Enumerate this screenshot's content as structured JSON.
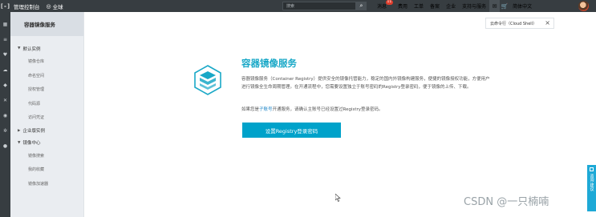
{
  "topbar": {
    "logo": "[-]",
    "console_label": "管理控制台",
    "region_label": "全球",
    "search_placeholder": "搜索",
    "messages_label": "消息",
    "messages_count": "11",
    "links": [
      "费用",
      "工单",
      "备案",
      "企业",
      "支持与服务"
    ],
    "language_label": "简体中文"
  },
  "rail_icons": [
    "grid-icon",
    "list-icon",
    "heart-icon",
    "cloud-icon",
    "layers-icon",
    "cross-icon",
    "globe-icon",
    "node-icon",
    "dot-icon"
  ],
  "sidebar": {
    "title": "容器镜像服务",
    "groups": [
      {
        "label": "默认实例",
        "expanded": true,
        "items": [
          "镜像仓库",
          "命名空间",
          "授权管理",
          "代码源",
          "访问凭证"
        ]
      },
      {
        "label": "企业版实例",
        "expanded": false,
        "items": []
      },
      {
        "label": "镜像中心",
        "expanded": true,
        "items": [
          "镜像搜索",
          "我的收藏",
          "镜像加速器"
        ]
      }
    ]
  },
  "cloud_shell_tip": "云命令行（Cloud Shell）",
  "main": {
    "title": "容器镜像服务",
    "description": "容器镜像服务（Container Registry）提供安全的镜像托管能力，稳定的国内外镜像构建服务，便捷的镜像授权功能，方便用户进行镜像全生命周期管理。在开通流程中，您需要设置独立于账号密码的Registry登录密码，便于镜像的上传、下载。",
    "note_prefix": "如果您是",
    "note_link": "子账号",
    "note_suffix": "开通服务，请确认主账号已经设置过Registry登录密码。",
    "button_label": "设置Registry登录密码"
  },
  "side_tab_label": "咨询·建议",
  "watermark": "CSDN @一只楠喃",
  "colors": {
    "topbar": "#373d41",
    "accent": "#00a2ca",
    "title": "#19a8c7",
    "link": "#1c84c6"
  }
}
